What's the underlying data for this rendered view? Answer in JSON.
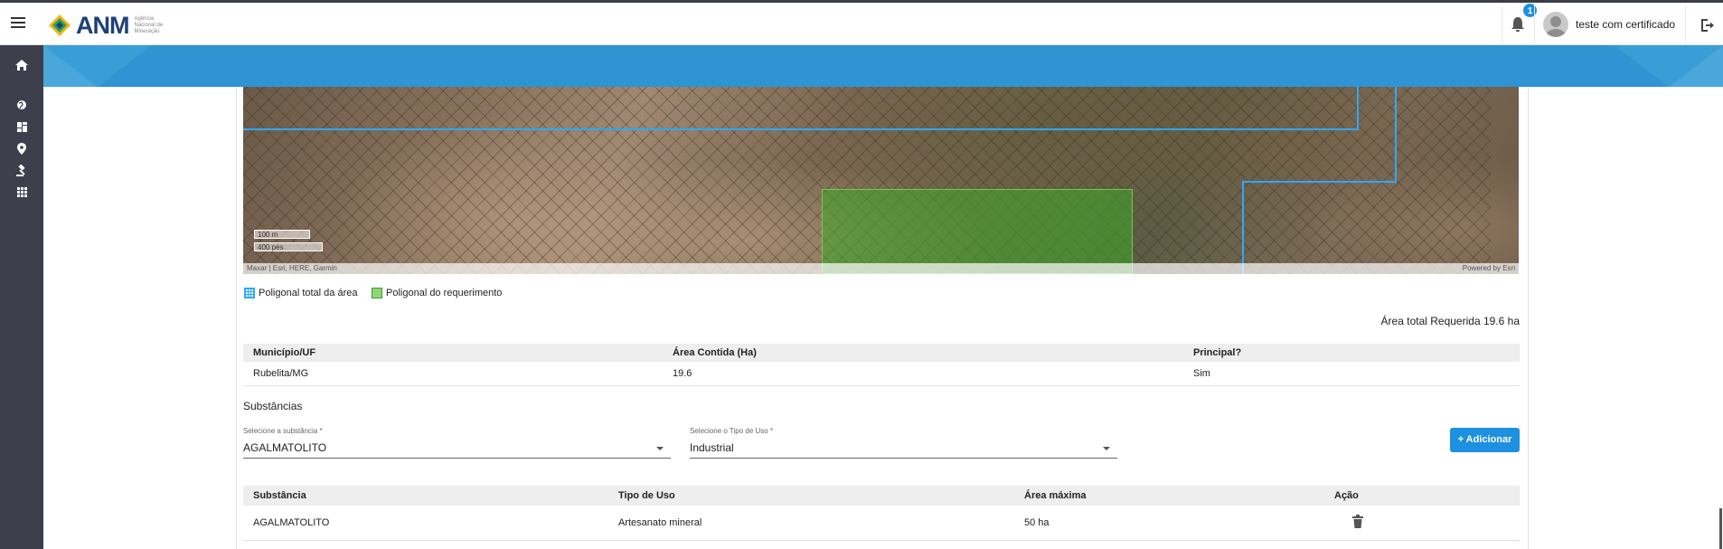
{
  "header": {
    "logo_text": "ANM",
    "logo_subtext": "Agência Nacional de Mineração",
    "notification_count": "1",
    "user_name": "teste com certificado"
  },
  "map": {
    "scale_metric": "100 m",
    "scale_imperial": "400 pés",
    "attribution_left": "Maxar | Esri, HERE, Garmin",
    "attribution_right": "Powered by Esri"
  },
  "legend": {
    "total_label": "Poligonal total da área",
    "request_label": "Poligonal do requerimento"
  },
  "area_total": "Área total Requerida 19.6 ha",
  "municipios": {
    "headers": [
      "Município/UF",
      "Área Contida (Ha)",
      "Principal?"
    ],
    "rows": [
      [
        "Rubelita/MG",
        "19.6",
        "Sim"
      ]
    ]
  },
  "substancias": {
    "title": "Substâncias",
    "substance_label": "Selecione a substância *",
    "substance_value": "AGALMATOLITO",
    "use_label": "Selecione o Tipo de Uso *",
    "use_value": "Industrial",
    "add_button": "+ Adicionar",
    "headers": [
      "Substância",
      "Tipo de Uso",
      "Área máxima",
      "Ação"
    ],
    "rows": [
      [
        "AGALMATOLITO",
        "Artesanato mineral",
        "50 ha"
      ]
    ]
  },
  "colors": {
    "accent": "#1e90e0",
    "band": "#2f94d2",
    "sidebar": "#3d404c"
  }
}
